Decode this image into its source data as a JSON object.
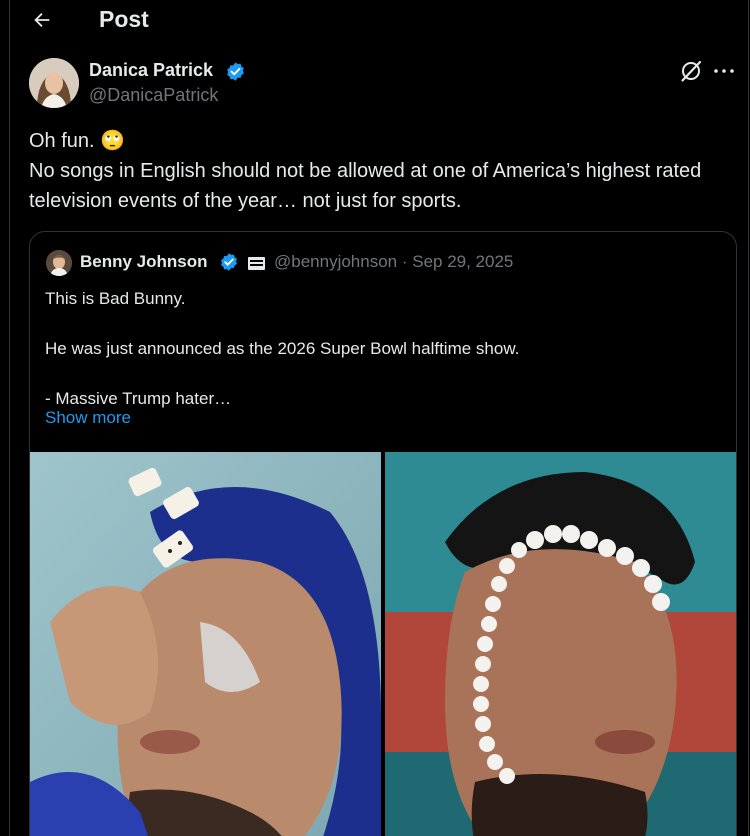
{
  "header": {
    "title": "Post",
    "back_icon": "arrow-left-icon"
  },
  "author": {
    "name": "Danica Patrick",
    "handle": "@DanicaPatrick",
    "verified": true
  },
  "tweet": {
    "text": "Oh fun. 🙄\nNo songs in English should not be allowed at one of America’s highest rated television events of the year… not just for sports."
  },
  "quote": {
    "name": "Benny Johnson",
    "verified": true,
    "meta": "@bennyjohnson · Sep 29, 2025",
    "text": "This is Bad Bunny.\n\nHe was just announced as the 2026 Super Bowl halftime show.\n\n- Massive Trump hater…",
    "show_more": "Show more"
  },
  "colors": {
    "background": "#000000",
    "text": "#e7e9ea",
    "muted": "#71767b",
    "accent": "#1d9bf0",
    "border": "#2f3336"
  }
}
